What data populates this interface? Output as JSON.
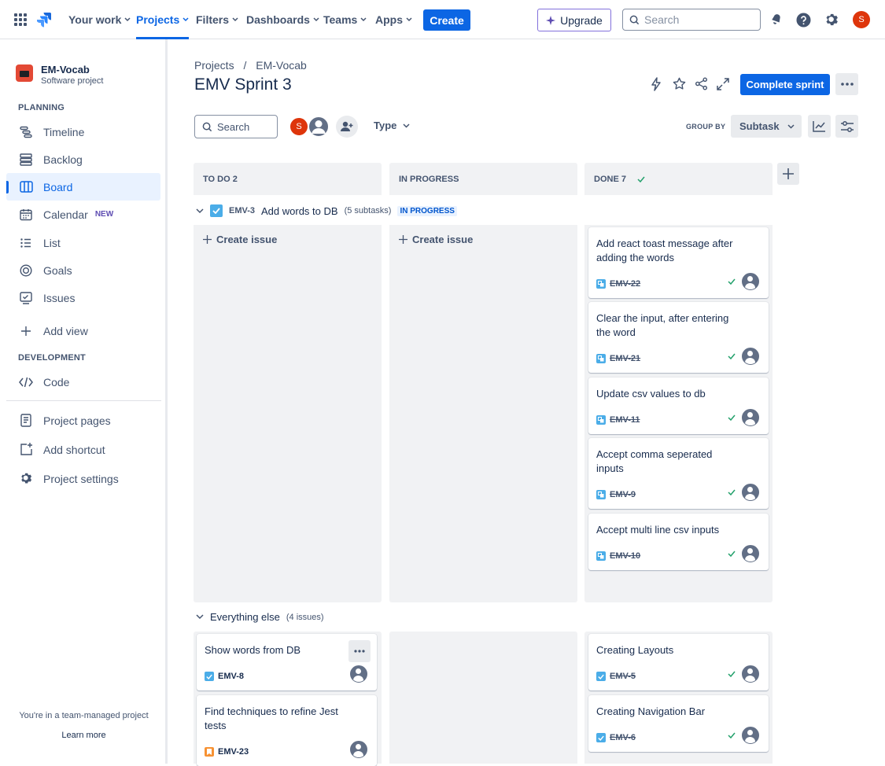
{
  "nav": {
    "your_work": "Your work",
    "projects": "Projects",
    "filters": "Filters",
    "dashboards": "Dashboards",
    "teams": "Teams",
    "apps": "Apps",
    "create": "Create",
    "upgrade": "Upgrade",
    "search_placeholder": "Search",
    "user_initial": "S"
  },
  "sidebar": {
    "project_name": "EM-Vocab",
    "project_type": "Software project",
    "planning_heading": "PLANNING",
    "items": [
      {
        "label": "Timeline"
      },
      {
        "label": "Backlog"
      },
      {
        "label": "Board"
      },
      {
        "label": "Calendar",
        "badge": "NEW"
      },
      {
        "label": "List"
      },
      {
        "label": "Goals"
      },
      {
        "label": "Issues"
      },
      {
        "label": "Add view"
      }
    ],
    "development_heading": "DEVELOPMENT",
    "code": "Code",
    "project_pages": "Project pages",
    "add_shortcut": "Add shortcut",
    "project_settings": "Project settings",
    "footer_text": "You're in a team-managed project",
    "learn_more": "Learn more"
  },
  "header": {
    "breadcrumb_projects": "Projects",
    "breadcrumb_sep": "/",
    "breadcrumb_project": "EM-Vocab",
    "title": "EMV Sprint 3",
    "complete_sprint": "Complete sprint"
  },
  "toolbar": {
    "search_placeholder": "Search",
    "avatar_initial": "S",
    "type": "Type",
    "group_by": "GROUP BY",
    "group_value": "Subtask"
  },
  "columns": {
    "todo": "TO DO 2",
    "in_progress": "IN PROGRESS",
    "done": "DONE 7"
  },
  "swimlane1": {
    "key": "EMV-3",
    "title": "Add words to DB",
    "count": "(5 subtasks)",
    "status": "IN PROGRESS",
    "create_issue": "Create issue",
    "done_cards": [
      {
        "text": "Add react toast message after adding the words",
        "key": "EMV-22"
      },
      {
        "text": "Clear the input, after entering the word",
        "key": "EMV-21"
      },
      {
        "text": "Update csv values to db",
        "key": "EMV-11"
      },
      {
        "text": "Accept comma seperated inputs",
        "key": "EMV-9"
      },
      {
        "text": "Accept multi line csv inputs",
        "key": "EMV-10"
      }
    ]
  },
  "swimlane2": {
    "title": "Everything else",
    "count": "(4 issues)",
    "todo_cards": [
      {
        "text": "Show words from DB",
        "key": "EMV-8"
      },
      {
        "text": "Find techniques to refine Jest tests",
        "key": "EMV-23"
      }
    ],
    "done_cards": [
      {
        "text": "Creating Layouts",
        "key": "EMV-5"
      },
      {
        "text": "Creating Navigation Bar",
        "key": "EMV-6"
      }
    ]
  },
  "colors": {
    "primary": "#0c66e4",
    "avatar_red": "#de350b",
    "check_green": "#22a06b",
    "subtask_blue": "#4bade8",
    "story_orange": "#f79233"
  }
}
